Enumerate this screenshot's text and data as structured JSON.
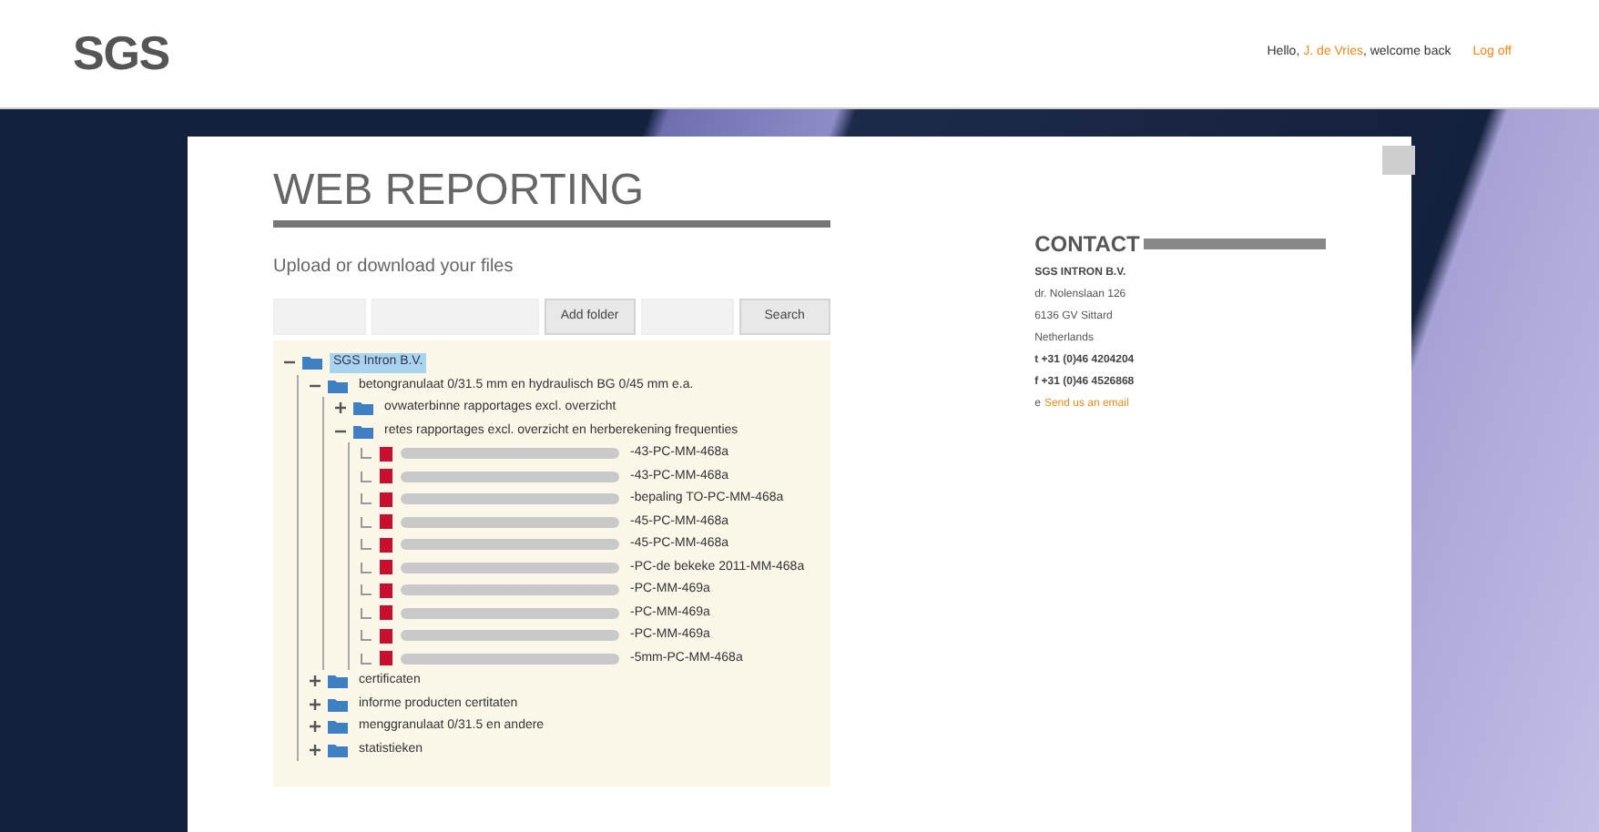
{
  "header": {
    "logo": "SGS",
    "greeting": "Hello,",
    "user": "J. de Vries",
    "welcome": ", welcome back",
    "logout": "Log off"
  },
  "main": {
    "title": "WEB REPORTING",
    "subtitle": "Upload or download your files",
    "toolbar": [
      {
        "disabled": true
      },
      {
        "disabled": true
      },
      {
        "label": "Add folder",
        "disabled": false
      },
      {
        "disabled": true
      },
      {
        "label": "Search",
        "disabled": false
      }
    ],
    "tree": [
      {
        "kind": "folder",
        "label": "SGS Intron B.V.",
        "selected": true,
        "expanded": true,
        "children": [
          {
            "kind": "folder",
            "label": "betongranulaat 0/31.5 mm en hydraulisch BG 0/45 mm e.a.",
            "selected": false,
            "expanded": true,
            "children": [
              {
                "kind": "folder",
                "label": "ovwaterbinne rapportages excl. overzicht",
                "selected": false,
                "expanded": false
              },
              {
                "kind": "folder",
                "label": "retes rapportages excl. overzicht en herberekening frequenties",
                "selected": false,
                "expanded": true,
                "children": [
                  {
                    "kind": "file",
                    "label": "-43-PC-MM-468a",
                    "selected": false
                  },
                  {
                    "kind": "file",
                    "label": "-43-PC-MM-468a",
                    "selected": false
                  },
                  {
                    "kind": "file",
                    "label": "-bepaling TO-PC-MM-468a",
                    "selected": false
                  },
                  {
                    "kind": "file",
                    "label": "-45-PC-MM-468a",
                    "selected": false
                  },
                  {
                    "kind": "file",
                    "label": "-45-PC-MM-468a",
                    "selected": false
                  },
                  {
                    "kind": "file",
                    "label": "-PC-de bekeke 2011-MM-468a",
                    "selected": false
                  },
                  {
                    "kind": "file",
                    "label": "-PC-MM-469a",
                    "selected": false
                  },
                  {
                    "kind": "file",
                    "label": "-PC-MM-469a",
                    "selected": false
                  },
                  {
                    "kind": "file",
                    "label": "-PC-MM-469a",
                    "selected": false
                  },
                  {
                    "kind": "file",
                    "label": "-5mm-PC-MM-468a",
                    "selected": false
                  }
                ]
              }
            ]
          },
          {
            "kind": "folder",
            "label": "certificaten",
            "selected": false,
            "expanded": false
          },
          {
            "kind": "folder",
            "label": "informe producten certitaten",
            "selected": false,
            "expanded": false
          },
          {
            "kind": "folder",
            "label": "menggranulaat 0/31.5 en andere",
            "selected": false,
            "expanded": false
          },
          {
            "kind": "folder",
            "label": "statistieken",
            "selected": false,
            "expanded": false
          }
        ]
      }
    ]
  },
  "contact": {
    "title": "CONTACT",
    "company": "SGS INTRON B.V.",
    "lines": [
      "dr. Nolenslaan 126",
      "6136 GV Sittard",
      "Netherlands"
    ],
    "phone": "t +31 (0)46 4204204",
    "fax": "f +31 (0)46 4526868",
    "email_prefix": "e",
    "email_link": "Send us an email"
  }
}
